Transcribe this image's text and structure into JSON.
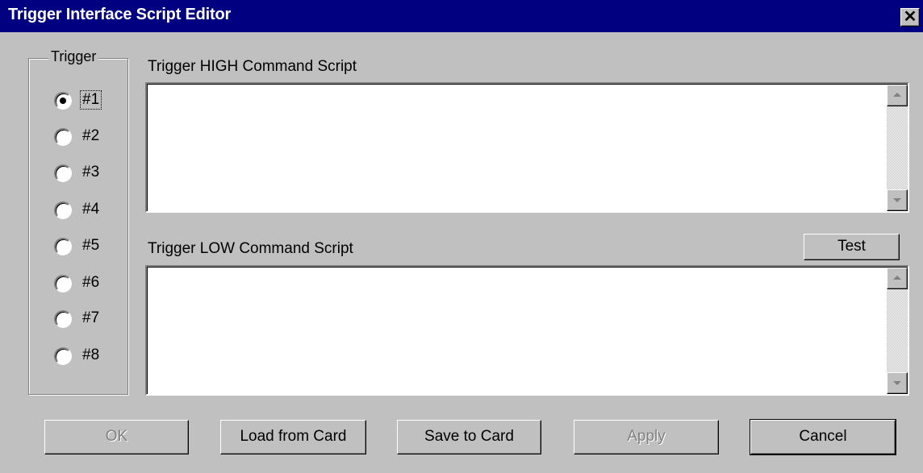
{
  "window": {
    "title": "Trigger Interface Script Editor",
    "close_glyph": "✕"
  },
  "trigger_group": {
    "label": "Trigger",
    "options": [
      "#1",
      "#2",
      "#3",
      "#4",
      "#5",
      "#6",
      "#7",
      "#8"
    ],
    "selected": "#1"
  },
  "high_script": {
    "label": "Trigger HIGH Command Script",
    "value": ""
  },
  "low_script": {
    "label": "Trigger LOW Command Script",
    "value": ""
  },
  "buttons": {
    "test": "Test",
    "ok": "OK",
    "load": "Load from Card",
    "save": "Save to Card",
    "apply": "Apply",
    "cancel": "Cancel"
  },
  "colors": {
    "titlebar": "#000080",
    "face": "#c0c0c0"
  }
}
